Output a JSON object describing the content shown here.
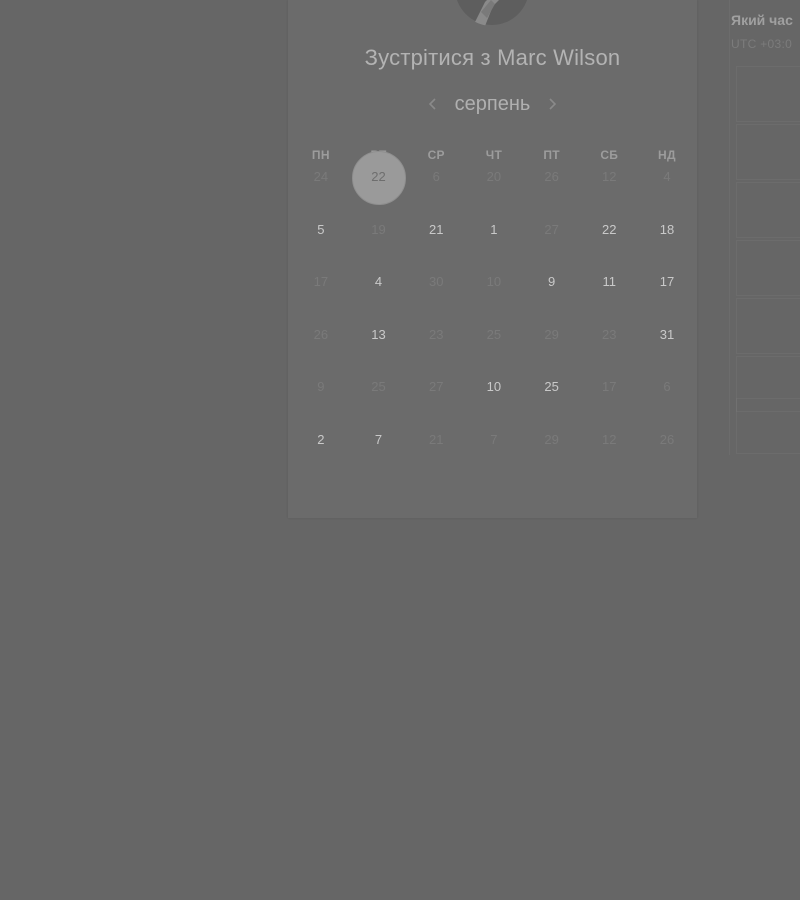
{
  "booking": {
    "title": "Зустрітися з Marc Wilson",
    "month": "серпень",
    "prev_icon": "chevron-left-icon",
    "next_icon": "chevron-right-icon",
    "weekdays": [
      "ПН",
      "ВТ",
      "СР",
      "ЧТ",
      "ПТ",
      "СБ",
      "НД"
    ],
    "weeks": [
      [
        {
          "d": "24",
          "a": false
        },
        {
          "d": "22",
          "a": false,
          "s": true
        },
        {
          "d": "6",
          "a": false
        },
        {
          "d": "20",
          "a": false
        },
        {
          "d": "26",
          "a": false
        },
        {
          "d": "12",
          "a": false
        },
        {
          "d": "4",
          "a": false
        }
      ],
      [
        {
          "d": "5",
          "a": true
        },
        {
          "d": "19",
          "a": false
        },
        {
          "d": "21",
          "a": true
        },
        {
          "d": "1",
          "a": true
        },
        {
          "d": "27",
          "a": false
        },
        {
          "d": "22",
          "a": true
        },
        {
          "d": "18",
          "a": true
        }
      ],
      [
        {
          "d": "17",
          "a": false
        },
        {
          "d": "4",
          "a": true
        },
        {
          "d": "30",
          "a": false
        },
        {
          "d": "10",
          "a": false
        },
        {
          "d": "9",
          "a": true
        },
        {
          "d": "11",
          "a": true
        },
        {
          "d": "17",
          "a": true
        }
      ],
      [
        {
          "d": "26",
          "a": false
        },
        {
          "d": "13",
          "a": true
        },
        {
          "d": "23",
          "a": false
        },
        {
          "d": "25",
          "a": false
        },
        {
          "d": "29",
          "a": false
        },
        {
          "d": "23",
          "a": false
        },
        {
          "d": "31",
          "a": true
        }
      ],
      [
        {
          "d": "9",
          "a": false
        },
        {
          "d": "25",
          "a": false
        },
        {
          "d": "27",
          "a": false
        },
        {
          "d": "10",
          "a": true
        },
        {
          "d": "25",
          "a": true
        },
        {
          "d": "17",
          "a": false
        },
        {
          "d": "6",
          "a": false
        }
      ],
      [
        {
          "d": "2",
          "a": true
        },
        {
          "d": "7",
          "a": true
        },
        {
          "d": "21",
          "a": false
        },
        {
          "d": "7",
          "a": false
        },
        {
          "d": "29",
          "a": false
        },
        {
          "d": "12",
          "a": false
        },
        {
          "d": "26",
          "a": false
        }
      ]
    ]
  },
  "time_panel": {
    "title": "Який час",
    "timezone": "UTC +03:0"
  }
}
